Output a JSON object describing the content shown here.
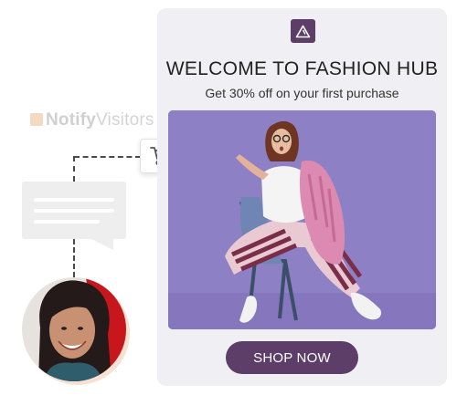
{
  "watermark": {
    "brand_bold": "Notify",
    "brand_light": "Visitors"
  },
  "card": {
    "title": "WELCOME TO FASHION HUB",
    "subtitle": "Get 30% off on your first purchase",
    "cta_label": "SHOP NOW",
    "logo_icon": "triangle-logo-icon"
  },
  "icons": {
    "cart": "shopping-cart-icon"
  },
  "colors": {
    "brand_purple": "#5c3e68",
    "card_bg": "#f0eff3",
    "hero_bg": "#8e80c4",
    "bubble_bg": "#eeeeee"
  }
}
